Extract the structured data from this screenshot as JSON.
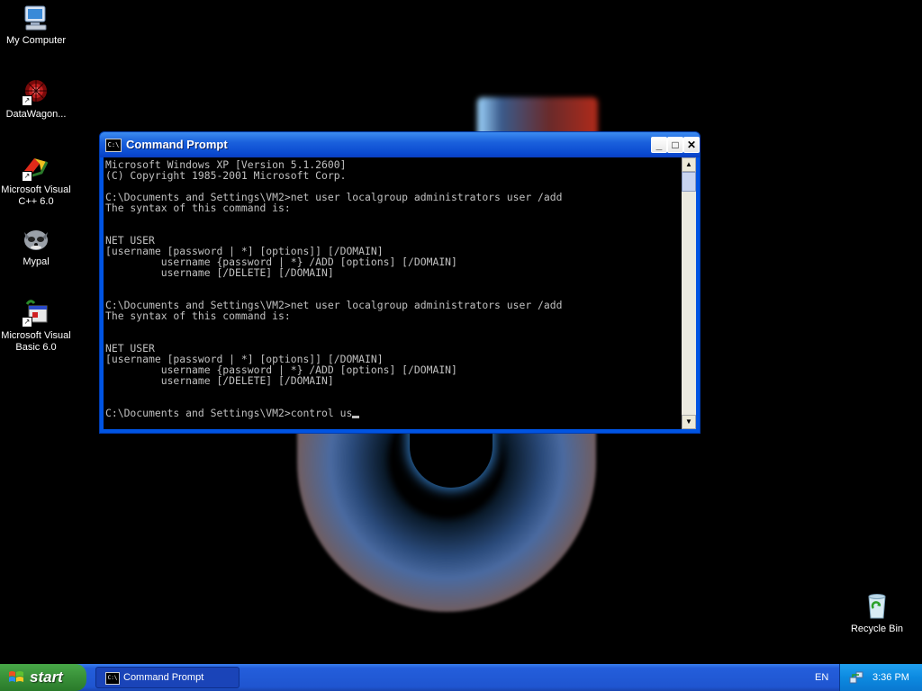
{
  "desktop": {
    "icons": [
      {
        "label": "My Computer",
        "icon": "my-computer-icon"
      },
      {
        "label": "DataWagon...",
        "icon": "datawagon-icon"
      },
      {
        "label": "Microsoft Visual C++ 6.0",
        "icon": "visual-cpp-icon"
      },
      {
        "label": "Mypal",
        "icon": "mypal-icon"
      },
      {
        "label": "Microsoft Visual Basic 6.0",
        "icon": "visual-basic-icon"
      },
      {
        "label": "Recycle Bin",
        "icon": "recycle-bin-icon"
      }
    ]
  },
  "window": {
    "title": "Command Prompt",
    "buttons": {
      "minimize": "_",
      "maximize": "□",
      "close": "✕"
    },
    "console_lines": [
      "Microsoft Windows XP [Version 5.1.2600]",
      "(C) Copyright 1985-2001 Microsoft Corp.",
      "",
      "C:\\Documents and Settings\\VM2>net user localgroup administrators user /add",
      "The syntax of this command is:",
      "",
      "",
      "NET USER",
      "[username [password | *] [options]] [/DOMAIN]",
      "         username {password | *} /ADD [options] [/DOMAIN]",
      "         username [/DELETE] [/DOMAIN]",
      "",
      "",
      "C:\\Documents and Settings\\VM2>net user localgroup administrators user /add",
      "The syntax of this command is:",
      "",
      "",
      "NET USER",
      "[username [password | *] [options]] [/DOMAIN]",
      "         username {password | *} /ADD [options] [/DOMAIN]",
      "         username [/DELETE] [/DOMAIN]",
      "",
      ""
    ],
    "prompt": "C:\\Documents and Settings\\VM2>",
    "current_input": "control us"
  },
  "taskbar": {
    "start_label": "start",
    "tasks": [
      {
        "label": "Command Prompt"
      }
    ],
    "language": "EN",
    "clock": "3:36 PM"
  }
}
